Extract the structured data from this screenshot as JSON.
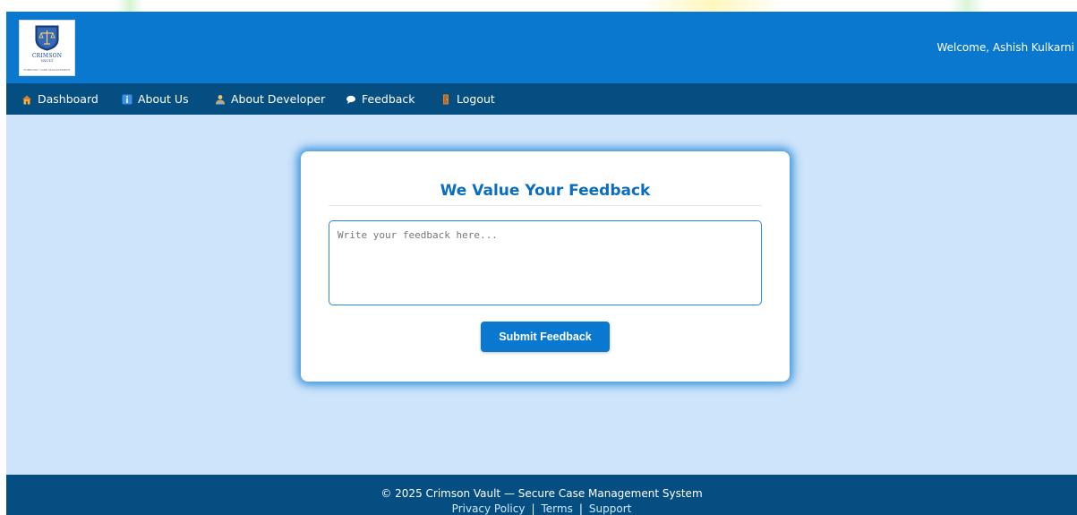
{
  "header": {
    "logo": {
      "name": "CRIMSON",
      "sub": "VAULT",
      "tagline": "FORENSIC CASE MANAGEMENT"
    },
    "welcome_text": "Welcome, Ashish Kulkarni"
  },
  "nav": {
    "items": [
      {
        "label": "Dashboard",
        "icon": "house-icon"
      },
      {
        "label": "About Us",
        "icon": "info-icon"
      },
      {
        "label": "About Developer",
        "icon": "developer-icon"
      },
      {
        "label": "Feedback",
        "icon": "speech-bubble-icon"
      },
      {
        "label": "Logout",
        "icon": "door-icon"
      }
    ]
  },
  "feedback_form": {
    "title": "We Value Your Feedback",
    "textarea_placeholder": "Write your feedback here...",
    "textarea_value": "",
    "submit_label": "Submit Feedback"
  },
  "footer": {
    "copyright": "© 2025 Crimson Vault — Secure Case Management System",
    "links": [
      "Privacy Policy",
      "Terms",
      "Support"
    ],
    "separator": "|"
  },
  "colors": {
    "header_bg": "#0a78cf",
    "nav_bg": "#054e82",
    "page_bg": "#cde4fb",
    "accent": "#0a6dbd",
    "footer_bg": "#054e82"
  }
}
